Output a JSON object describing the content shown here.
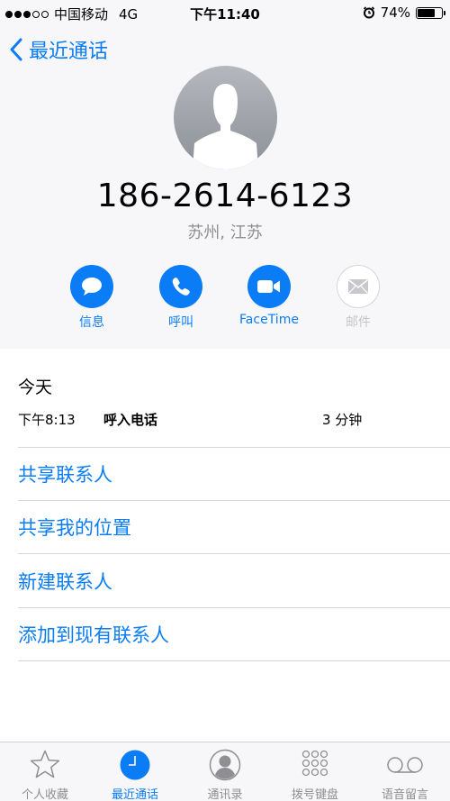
{
  "status_bar": {
    "carrier": "中国移动",
    "network": "4G",
    "time": "下午11:40",
    "battery_pct": "74%",
    "battery_level": 0.74
  },
  "nav": {
    "back_label": "最近通话"
  },
  "contact": {
    "phone": "186-2614-6123",
    "location": "苏州, 江苏"
  },
  "actions": [
    {
      "label": "信息",
      "icon": "message-icon",
      "enabled": true
    },
    {
      "label": "呼叫",
      "icon": "phone-icon",
      "enabled": true
    },
    {
      "label": "FaceTime",
      "icon": "video-icon",
      "enabled": true
    },
    {
      "label": "邮件",
      "icon": "mail-icon",
      "enabled": false
    }
  ],
  "recent": {
    "date_heading": "今天",
    "calls": [
      {
        "time": "下午8:13",
        "type": "呼入电话",
        "duration": "3 分钟"
      }
    ]
  },
  "options": [
    {
      "label": "共享联系人"
    },
    {
      "label": "共享我的位置"
    },
    {
      "label": "新建联系人"
    },
    {
      "label": "添加到现有联系人"
    }
  ],
  "tabs": [
    {
      "label": "个人收藏",
      "icon": "star-icon",
      "active": false
    },
    {
      "label": "最近通话",
      "icon": "clock-icon",
      "active": true
    },
    {
      "label": "通讯录",
      "icon": "contacts-icon",
      "active": false
    },
    {
      "label": "拨号键盘",
      "icon": "keypad-icon",
      "active": false
    },
    {
      "label": "语音留言",
      "icon": "voicemail-icon",
      "active": false
    }
  ],
  "colors": {
    "accent": "#0a7cf5",
    "gray": "#8e8e93",
    "background": "#f7f7f9"
  }
}
